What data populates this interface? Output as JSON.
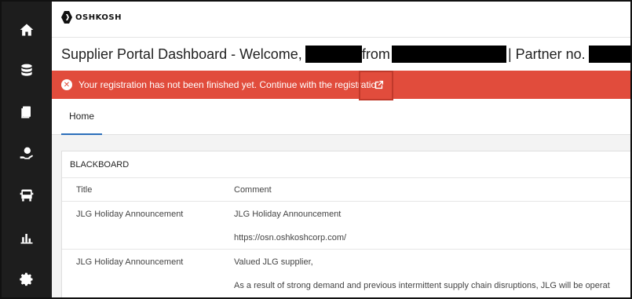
{
  "sidebar": {
    "items": [
      {
        "icon": "home-icon"
      },
      {
        "icon": "database-icon"
      },
      {
        "icon": "documents-icon"
      },
      {
        "icon": "help-hand-icon"
      },
      {
        "icon": "truck-icon"
      },
      {
        "icon": "bar-chart-icon"
      },
      {
        "icon": "gear-icon"
      }
    ]
  },
  "logo": {
    "text": "OSHKOSH"
  },
  "header": {
    "title_prefix": "Supplier Portal Dashboard - Welcome,",
    "title_from": "from",
    "title_partner": "| Partner no."
  },
  "alert": {
    "icon": "error-circle-icon",
    "text": "Your registration has not been finished yet. Continue with the registratio",
    "link_icon": "external-link-icon"
  },
  "tabs": [
    {
      "label": "Home"
    }
  ],
  "blackboard": {
    "title": "BLACKBOARD",
    "columns": [
      "Title",
      "Comment"
    ],
    "rows": [
      {
        "title": "JLG Holiday Announcement",
        "comment": [
          "JLG Holiday Announcement",
          "https://osn.oshkoshcorp.com/"
        ]
      },
      {
        "title": "JLG Holiday Announcement",
        "comment": [
          "Valued JLG supplier,",
          "As a result of strong demand and previous intermittent supply chain disruptions, JLG will be operat"
        ]
      }
    ]
  },
  "colors": {
    "sidebar": "#1d1d1d",
    "alert": "#e14c3c",
    "tab_underline": "#2c6fbb",
    "highlight": "#c0392b"
  }
}
